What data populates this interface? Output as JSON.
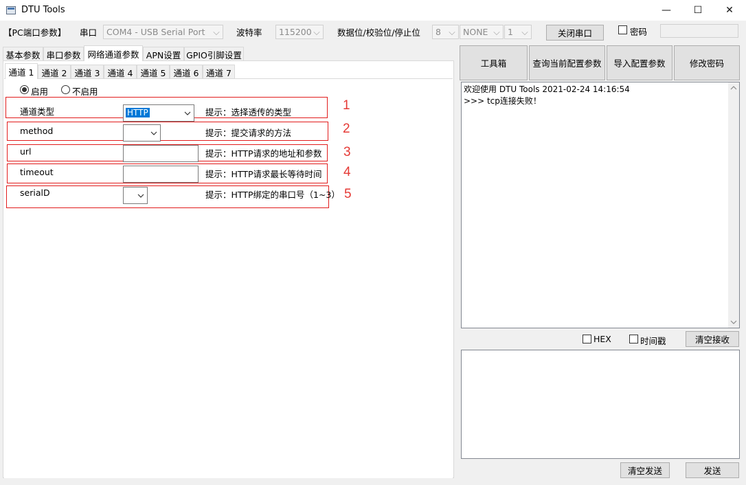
{
  "window": {
    "title": "DTU Tools",
    "minimize": "—",
    "maximize": "☐",
    "close": "✕"
  },
  "toolbar": {
    "pc_params_label": "【PC端口参数】",
    "port_label": "串口",
    "port_value": "COM4 - USB Serial Port",
    "baud_label": "波特率",
    "baud_value": "115200",
    "data_parity_stop_label": "数据位/校验位/停止位",
    "databits_value": "8",
    "parity_value": "NONE",
    "stopbits_value": "1",
    "close_port_button": "关闭串口",
    "password_label": "密码"
  },
  "top_tabs": [
    "基本参数",
    "串口参数",
    "网络通道参数",
    "APN设置",
    "GPIO引脚设置"
  ],
  "channel_tabs": [
    "通道 1",
    "通道 2",
    "通道 3",
    "通道 4",
    "通道 5",
    "通道 6",
    "通道 7"
  ],
  "channel_form": {
    "enable_label": "启用",
    "disable_label": "不启用",
    "rows": [
      {
        "label": "通道类型",
        "value": "HTTP",
        "hint": "提示：选择透传的类型",
        "num": "1"
      },
      {
        "label": "method",
        "value": "",
        "hint": "提示：提交请求的方法",
        "num": "2"
      },
      {
        "label": "url",
        "value": "",
        "hint": "提示：HTTP请求的地址和参数",
        "num": "3"
      },
      {
        "label": "timeout",
        "value": "",
        "hint": "提示：HTTP请求最长等待时间",
        "num": "4"
      },
      {
        "label": "serialD",
        "value": "",
        "hint": "提示：HTTP绑定的串口号（1~3）",
        "num": "5"
      }
    ]
  },
  "right_buttons": [
    "工具箱",
    "查询当前配置参数",
    "导入配置参数",
    "修改密码"
  ],
  "log": {
    "lines": [
      "欢迎使用 DTU Tools 2021-02-24 14:16:54",
      ">>> tcp连接失败！"
    ]
  },
  "receive_options": {
    "hex_label": "HEX",
    "timestamp_label": "时间戳",
    "clear_receive_button": "清空接收"
  },
  "send": {
    "clear_send_button": "清空发送",
    "send_button": "发送"
  },
  "colors": {
    "annotation_red": "#e21c1c",
    "selection_blue": "#0078d7"
  }
}
